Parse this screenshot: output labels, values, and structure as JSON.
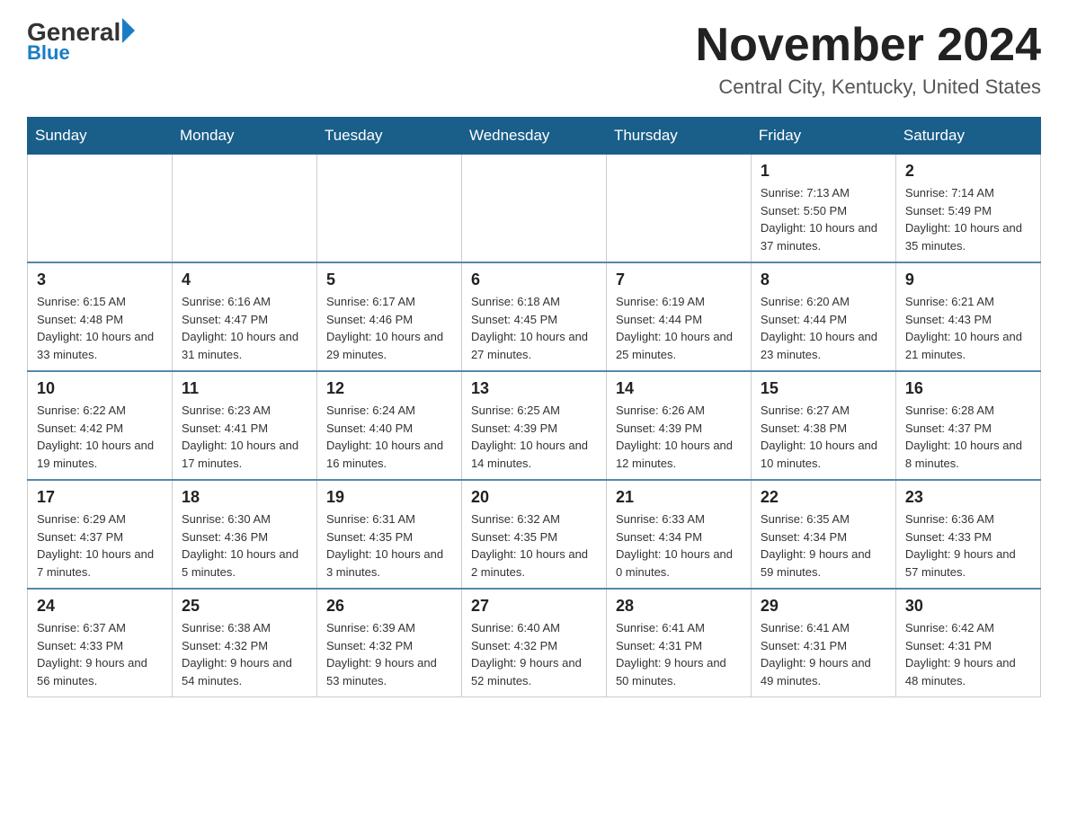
{
  "header": {
    "logo_general": "General",
    "logo_blue": "Blue",
    "calendar_title": "November 2024",
    "calendar_location": "Central City, Kentucky, United States"
  },
  "weekdays": [
    "Sunday",
    "Monday",
    "Tuesday",
    "Wednesday",
    "Thursday",
    "Friday",
    "Saturday"
  ],
  "weeks": [
    [
      {
        "day": "",
        "info": ""
      },
      {
        "day": "",
        "info": ""
      },
      {
        "day": "",
        "info": ""
      },
      {
        "day": "",
        "info": ""
      },
      {
        "day": "",
        "info": ""
      },
      {
        "day": "1",
        "info": "Sunrise: 7:13 AM\nSunset: 5:50 PM\nDaylight: 10 hours and 37 minutes."
      },
      {
        "day": "2",
        "info": "Sunrise: 7:14 AM\nSunset: 5:49 PM\nDaylight: 10 hours and 35 minutes."
      }
    ],
    [
      {
        "day": "3",
        "info": "Sunrise: 6:15 AM\nSunset: 4:48 PM\nDaylight: 10 hours and 33 minutes."
      },
      {
        "day": "4",
        "info": "Sunrise: 6:16 AM\nSunset: 4:47 PM\nDaylight: 10 hours and 31 minutes."
      },
      {
        "day": "5",
        "info": "Sunrise: 6:17 AM\nSunset: 4:46 PM\nDaylight: 10 hours and 29 minutes."
      },
      {
        "day": "6",
        "info": "Sunrise: 6:18 AM\nSunset: 4:45 PM\nDaylight: 10 hours and 27 minutes."
      },
      {
        "day": "7",
        "info": "Sunrise: 6:19 AM\nSunset: 4:44 PM\nDaylight: 10 hours and 25 minutes."
      },
      {
        "day": "8",
        "info": "Sunrise: 6:20 AM\nSunset: 4:44 PM\nDaylight: 10 hours and 23 minutes."
      },
      {
        "day": "9",
        "info": "Sunrise: 6:21 AM\nSunset: 4:43 PM\nDaylight: 10 hours and 21 minutes."
      }
    ],
    [
      {
        "day": "10",
        "info": "Sunrise: 6:22 AM\nSunset: 4:42 PM\nDaylight: 10 hours and 19 minutes."
      },
      {
        "day": "11",
        "info": "Sunrise: 6:23 AM\nSunset: 4:41 PM\nDaylight: 10 hours and 17 minutes."
      },
      {
        "day": "12",
        "info": "Sunrise: 6:24 AM\nSunset: 4:40 PM\nDaylight: 10 hours and 16 minutes."
      },
      {
        "day": "13",
        "info": "Sunrise: 6:25 AM\nSunset: 4:39 PM\nDaylight: 10 hours and 14 minutes."
      },
      {
        "day": "14",
        "info": "Sunrise: 6:26 AM\nSunset: 4:39 PM\nDaylight: 10 hours and 12 minutes."
      },
      {
        "day": "15",
        "info": "Sunrise: 6:27 AM\nSunset: 4:38 PM\nDaylight: 10 hours and 10 minutes."
      },
      {
        "day": "16",
        "info": "Sunrise: 6:28 AM\nSunset: 4:37 PM\nDaylight: 10 hours and 8 minutes."
      }
    ],
    [
      {
        "day": "17",
        "info": "Sunrise: 6:29 AM\nSunset: 4:37 PM\nDaylight: 10 hours and 7 minutes."
      },
      {
        "day": "18",
        "info": "Sunrise: 6:30 AM\nSunset: 4:36 PM\nDaylight: 10 hours and 5 minutes."
      },
      {
        "day": "19",
        "info": "Sunrise: 6:31 AM\nSunset: 4:35 PM\nDaylight: 10 hours and 3 minutes."
      },
      {
        "day": "20",
        "info": "Sunrise: 6:32 AM\nSunset: 4:35 PM\nDaylight: 10 hours and 2 minutes."
      },
      {
        "day": "21",
        "info": "Sunrise: 6:33 AM\nSunset: 4:34 PM\nDaylight: 10 hours and 0 minutes."
      },
      {
        "day": "22",
        "info": "Sunrise: 6:35 AM\nSunset: 4:34 PM\nDaylight: 9 hours and 59 minutes."
      },
      {
        "day": "23",
        "info": "Sunrise: 6:36 AM\nSunset: 4:33 PM\nDaylight: 9 hours and 57 minutes."
      }
    ],
    [
      {
        "day": "24",
        "info": "Sunrise: 6:37 AM\nSunset: 4:33 PM\nDaylight: 9 hours and 56 minutes."
      },
      {
        "day": "25",
        "info": "Sunrise: 6:38 AM\nSunset: 4:32 PM\nDaylight: 9 hours and 54 minutes."
      },
      {
        "day": "26",
        "info": "Sunrise: 6:39 AM\nSunset: 4:32 PM\nDaylight: 9 hours and 53 minutes."
      },
      {
        "day": "27",
        "info": "Sunrise: 6:40 AM\nSunset: 4:32 PM\nDaylight: 9 hours and 52 minutes."
      },
      {
        "day": "28",
        "info": "Sunrise: 6:41 AM\nSunset: 4:31 PM\nDaylight: 9 hours and 50 minutes."
      },
      {
        "day": "29",
        "info": "Sunrise: 6:41 AM\nSunset: 4:31 PM\nDaylight: 9 hours and 49 minutes."
      },
      {
        "day": "30",
        "info": "Sunrise: 6:42 AM\nSunset: 4:31 PM\nDaylight: 9 hours and 48 minutes."
      }
    ]
  ]
}
